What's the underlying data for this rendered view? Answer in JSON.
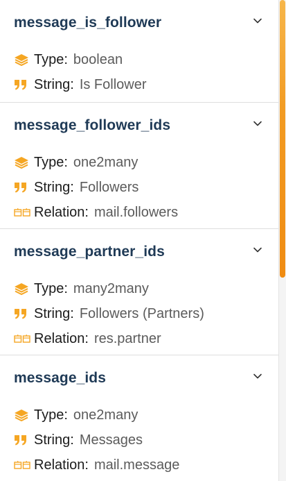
{
  "fields": [
    {
      "name": "message_is_follower",
      "rows": [
        {
          "icon": "layers-icon",
          "key": "Type:",
          "value": "boolean"
        },
        {
          "icon": "quote-icon",
          "key": "String:",
          "value": "Is Follower"
        }
      ]
    },
    {
      "name": "message_follower_ids",
      "rows": [
        {
          "icon": "layers-icon",
          "key": "Type:",
          "value": "one2many"
        },
        {
          "icon": "quote-icon",
          "key": "String:",
          "value": "Followers"
        },
        {
          "icon": "relation-icon",
          "key": "Relation:",
          "value": "mail.followers"
        }
      ]
    },
    {
      "name": "message_partner_ids",
      "rows": [
        {
          "icon": "layers-icon",
          "key": "Type:",
          "value": "many2many"
        },
        {
          "icon": "quote-icon",
          "key": "String:",
          "value": "Followers (Partners)"
        },
        {
          "icon": "relation-icon",
          "key": "Relation:",
          "value": "res.partner"
        }
      ]
    },
    {
      "name": "message_ids",
      "rows": [
        {
          "icon": "layers-icon",
          "key": "Type:",
          "value": "one2many"
        },
        {
          "icon": "quote-icon",
          "key": "String:",
          "value": "Messages"
        },
        {
          "icon": "relation-icon",
          "key": "Relation:",
          "value": "mail.message"
        }
      ]
    }
  ],
  "colors": {
    "accent": "#f5a623",
    "title": "#1f3a56",
    "value": "#5b5b5b"
  }
}
